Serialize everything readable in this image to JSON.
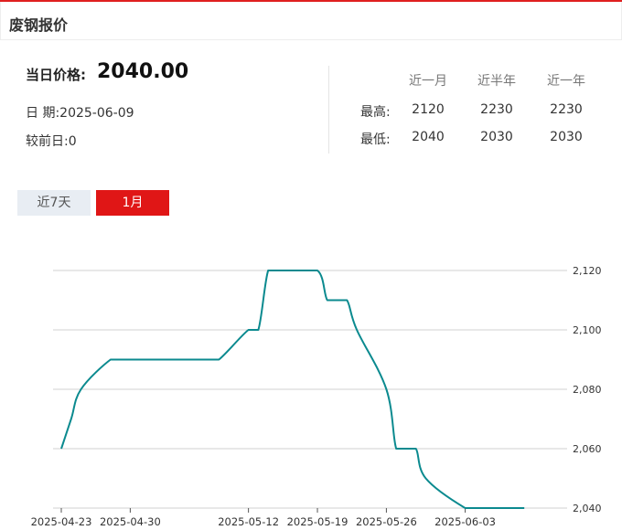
{
  "header": {
    "title": "废钢报价"
  },
  "summary": {
    "price_label": "当日价格:",
    "price_value": "2040.00",
    "date_label": "日 期:",
    "date_value": "2025-06-09",
    "change_label": "较前日:",
    "change_value": "0"
  },
  "stats": {
    "columns": [
      "近一月",
      "近半年",
      "近一年"
    ],
    "rows": [
      {
        "label": "最高:",
        "values": [
          "2120",
          "2230",
          "2230"
        ]
      },
      {
        "label": "最低:",
        "values": [
          "2040",
          "2030",
          "2030"
        ]
      }
    ]
  },
  "tabs": [
    {
      "label": "近7天",
      "active": false
    },
    {
      "label": "1月",
      "active": true
    }
  ],
  "chart_data": {
    "type": "line",
    "title": "",
    "xlabel": "",
    "ylabel": "",
    "x_tick_labels": [
      "2025-04-23",
      "2025-04-30",
      "2025-05-12",
      "2025-05-19",
      "2025-05-26",
      "2025-06-03"
    ],
    "y_tick_labels": [
      "2,120",
      "2,100",
      "2,080",
      "2,060",
      "2,040"
    ],
    "ylim": [
      2040,
      2120
    ],
    "y_axis_position": "right",
    "grid": "horizontal",
    "legend": "none",
    "line_color": "#0b8a8f",
    "series": [
      {
        "x": [
          "2025-04-23",
          "2025-04-24",
          "2025-04-25",
          "2025-04-28",
          "2025-04-29",
          "2025-04-30",
          "2025-05-06",
          "2025-05-07",
          "2025-05-08",
          "2025-05-09",
          "2025-05-12",
          "2025-05-13",
          "2025-05-14",
          "2025-05-15",
          "2025-05-16",
          "2025-05-19",
          "2025-05-20",
          "2025-05-21",
          "2025-05-22",
          "2025-05-23",
          "2025-05-26",
          "2025-05-27",
          "2025-05-28",
          "2025-05-29",
          "2025-05-30",
          "2025-06-03",
          "2025-06-04",
          "2025-06-05",
          "2025-06-06",
          "2025-06-09"
        ],
        "values": [
          2060,
          2070,
          2080,
          2090,
          2090,
          2090,
          2090,
          2090,
          2090,
          2090,
          2100,
          2100,
          2120,
          2120,
          2120,
          2120,
          2110,
          2110,
          2110,
          2100,
          2080,
          2060,
          2060,
          2060,
          2050,
          2040,
          2040,
          2040,
          2040,
          2040
        ]
      }
    ]
  }
}
